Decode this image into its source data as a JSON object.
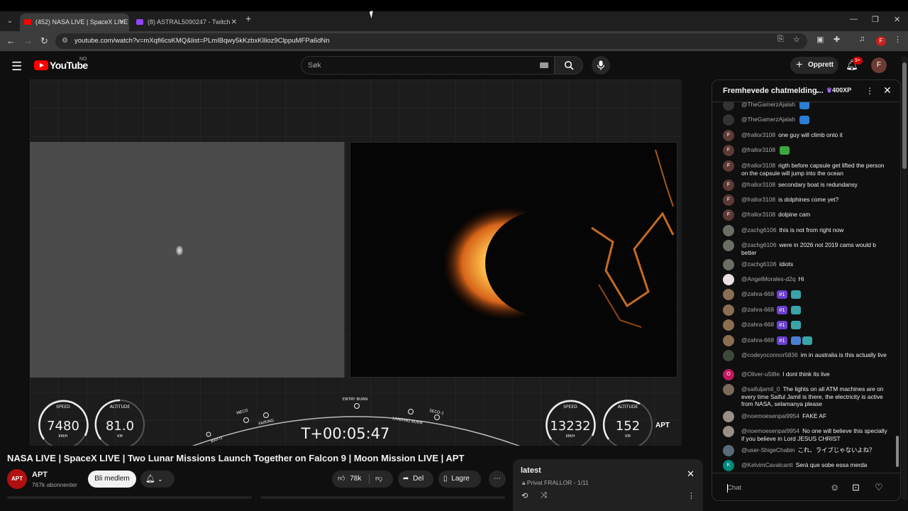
{
  "browser": {
    "tabs": [
      {
        "title": "(452) NASA LIVE | SpaceX LIVE |",
        "active": true
      },
      {
        "title": "(8) ASTRAL5090247 - Twitch",
        "active": false
      }
    ],
    "url": "youtube.com/watch?v=mXqfi6csKMQ&list=PLmIBqwy5kKzbxKIlioz9ClppuMFPa6dNn",
    "profile_initial": "F"
  },
  "header": {
    "logo": "YouTube",
    "country": "NO",
    "search_placeholder": "Søk",
    "create_label": "Opprett",
    "notification_count": "9+",
    "avatar_initial": "F"
  },
  "video": {
    "hud": {
      "left_speed": "7480",
      "left_altitude": "81.0",
      "right_speed": "13232",
      "right_altitude": "152",
      "speed_label": "SPEED",
      "altitude_label": "ALTITUDE",
      "speed_unit": "KM/H",
      "altitude_unit": "KM",
      "timer": "T+00:05:47",
      "events": [
        "MAX-Q",
        "MECO",
        "FAIRING",
        "ENTRY BURN",
        "LANDING BURN",
        "SECO-1"
      ]
    },
    "overlay_logo": "APT",
    "title": "NASA LIVE | SpaceX LIVE | Two Lunar Missions Launch Together on Falcon 9 | Moon Mission LIVE | APT",
    "channel": {
      "name": "APT",
      "subscribers": "767k abonnenter",
      "avatar_text": "APT"
    },
    "join_label": "Bli medlem",
    "like_count": "78k",
    "share_label": "Del",
    "save_label": "Lagre"
  },
  "playlist": {
    "title": "latest",
    "privacy": "Privat",
    "owner": "FRALLOR",
    "position": "1/11"
  },
  "chat": {
    "header_title": "Fremhevede chatmelding...",
    "xp": "400XP",
    "input_placeholder": "Chat",
    "messages": [
      {
        "author": "@TheGamerzAjalah",
        "text": "",
        "avatar": "",
        "avatar_color": "#333333",
        "badge": "",
        "emotes": [
          "#2a7fd4"
        ]
      },
      {
        "author": "@TheGamerzAjalah",
        "text": "",
        "avatar": "",
        "avatar_color": "#333333",
        "badge": "",
        "emotes": [
          "#2a7fd4"
        ]
      },
      {
        "author": "@frallor3108",
        "text": "one guy will climb onto it",
        "avatar": "F",
        "avatar_color": "#5d3a36",
        "badge": "",
        "emotes": []
      },
      {
        "author": "@frallor3108",
        "text": "",
        "avatar": "F",
        "avatar_color": "#5d3a36",
        "badge": "",
        "emotes": [
          "#3da63d"
        ]
      },
      {
        "author": "@frallor3108",
        "text": "rigth before capsule get lifted the person on the capsule will jump into the ocean",
        "avatar": "F",
        "avatar_color": "#5d3a36",
        "badge": "",
        "emotes": []
      },
      {
        "author": "@frallor3108",
        "text": "secondary boat is redundansy",
        "avatar": "F",
        "avatar_color": "#5d3a36",
        "badge": "",
        "emotes": []
      },
      {
        "author": "@frallor3108",
        "text": "is dolphines come yet?",
        "avatar": "F",
        "avatar_color": "#5d3a36",
        "badge": "",
        "emotes": []
      },
      {
        "author": "@frallor3108",
        "text": "dolpine cam",
        "avatar": "F",
        "avatar_color": "#5d3a36",
        "badge": "",
        "emotes": []
      },
      {
        "author": "@zachg6106",
        "text": "this is not from right now",
        "avatar": "",
        "avatar_color": "#6a6f66",
        "badge": "",
        "emotes": []
      },
      {
        "author": "@zachg6106",
        "text": "were in 2026 not 2019 cams would b better",
        "avatar": "",
        "avatar_color": "#6a6f66",
        "badge": "",
        "emotes": []
      },
      {
        "author": "@zachg6106",
        "text": "idiots",
        "avatar": "",
        "avatar_color": "#6a6f66",
        "badge": "",
        "emotes": []
      },
      {
        "author": "@AngelMorales-d2q",
        "text": "Hi",
        "avatar": "",
        "avatar_color": "#e8e0e0",
        "badge": "",
        "emotes": []
      },
      {
        "author": "@zahra-668",
        "text": "",
        "avatar": "",
        "avatar_color": "#8a6e52",
        "badge": "#1",
        "emotes": [
          "#3aa3a8"
        ]
      },
      {
        "author": "@zahra-668",
        "text": "",
        "avatar": "",
        "avatar_color": "#8a6e52",
        "badge": "#1",
        "emotes": [
          "#3aa3a8"
        ]
      },
      {
        "author": "@zahra-668",
        "text": "",
        "avatar": "",
        "avatar_color": "#8a6e52",
        "badge": "#1",
        "emotes": [
          "#3aa3a8"
        ]
      },
      {
        "author": "@zahra-668",
        "text": "",
        "avatar": "",
        "avatar_color": "#8a6e52",
        "badge": "#1",
        "emotes": [
          "#4d7fd1",
          "#3aa3a8"
        ]
      },
      {
        "author": "@codeyoconnor5836",
        "text": "im in australia is this actually live",
        "avatar": "",
        "avatar_color": "#3d4a3a",
        "badge": "",
        "emotes": []
      },
      {
        "author": "@Oliver-u5t8e",
        "text": "I dont think its live",
        "avatar": "O",
        "avatar_color": "#c2185b",
        "badge": "",
        "emotes": []
      },
      {
        "author": "@saifuljamil_0",
        "text": "The lights on all ATM machines are on every time Saiful Jamil is there, the electricity is active from NASA, selamanya please",
        "avatar": "",
        "avatar_color": "#7a6a5a",
        "badge": "",
        "emotes": []
      },
      {
        "author": "@noemoesenpai9954",
        "text": "FAKE AF",
        "avatar": "",
        "avatar_color": "#9a8f86",
        "badge": "",
        "emotes": []
      },
      {
        "author": "@noemoesenpai9954",
        "text": "No one will believe this specially if you believe in Lord JESUS CHRIST",
        "avatar": "",
        "avatar_color": "#9a8f86",
        "badge": "",
        "emotes": []
      },
      {
        "author": "@user-ShigeChabin",
        "text": "これ、ライブじゃないよね？",
        "avatar": "",
        "avatar_color": "#5a6a7a",
        "badge": "",
        "emotes": []
      },
      {
        "author": "@KelvimCavalcanti",
        "text": "Será que sobe essa merda",
        "avatar": "K",
        "avatar_color": "#00897b",
        "badge": "",
        "emotes": []
      }
    ]
  }
}
